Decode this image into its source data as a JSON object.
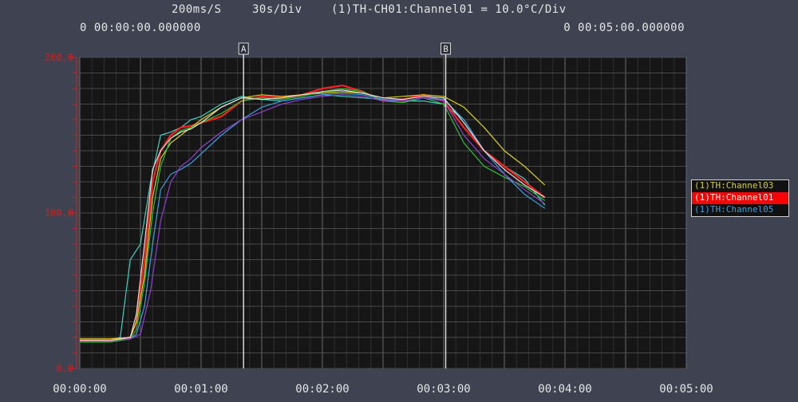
{
  "header": {
    "sample_rate": "200ms/S",
    "time_div": "30s/Div",
    "scale": "(1)TH-CH01:Channel01 = 10.0°C/Div",
    "time_start": "0 00:00:00.000000",
    "time_end": "0 00:05:00.000000"
  },
  "cursors": [
    {
      "label": "A",
      "time_s": 81
    },
    {
      "label": "B",
      "time_s": 181
    }
  ],
  "legend": [
    {
      "name": "(1)TH:Channel03",
      "color": "#d8d020",
      "selected": false
    },
    {
      "name": "(1)TH:Channel01",
      "color": "#ff2020",
      "selected": true
    },
    {
      "name": "(1)TH:Channel05",
      "color": "#3aa0e0",
      "selected": false
    }
  ],
  "chart_data": {
    "type": "line",
    "xlim": [
      0,
      300
    ],
    "ylim": [
      0,
      200
    ],
    "x_tick_labels": [
      "00:00:00",
      "00:01:00",
      "00:02:00",
      "00:03:00",
      "00:04:00",
      "00:05:00"
    ],
    "x_tick_values": [
      0,
      60,
      120,
      180,
      240,
      300
    ],
    "y_tick_labels": [
      "0.0",
      "100.0",
      "200.0"
    ],
    "y_tick_values": [
      0,
      100,
      200
    ],
    "grid": true,
    "legend_position": "right",
    "series": [
      {
        "color": "#40d0c0",
        "x": [
          0,
          15,
          20,
          22,
          25,
          30,
          35,
          40,
          45,
          50,
          55,
          60,
          70,
          80,
          90,
          100,
          110,
          120,
          130,
          140,
          150,
          160,
          170,
          180,
          190,
          200,
          210,
          220,
          230
        ],
        "y": [
          18,
          18,
          20,
          40,
          70,
          80,
          120,
          150,
          152,
          155,
          160,
          162,
          170,
          175,
          173,
          172,
          174,
          176,
          175,
          174,
          173,
          172,
          172,
          170,
          160,
          140,
          130,
          122,
          105
        ]
      },
      {
        "color": "#ff2020",
        "x": [
          0,
          15,
          25,
          28,
          32,
          36,
          40,
          45,
          50,
          55,
          60,
          70,
          80,
          90,
          100,
          110,
          120,
          130,
          140,
          150,
          160,
          170,
          180,
          190,
          200,
          210,
          220,
          230
        ],
        "y": [
          18,
          18,
          20,
          30,
          70,
          120,
          140,
          150,
          155,
          156,
          158,
          162,
          172,
          175,
          174,
          176,
          180,
          182,
          178,
          172,
          173,
          176,
          172,
          155,
          140,
          130,
          120,
          110
        ]
      },
      {
        "color": "#d8d020",
        "x": [
          0,
          15,
          25,
          28,
          32,
          36,
          40,
          45,
          50,
          55,
          60,
          70,
          80,
          90,
          100,
          110,
          120,
          130,
          140,
          150,
          160,
          170,
          180,
          190,
          200,
          210,
          220,
          230
        ],
        "y": [
          19,
          19,
          20,
          30,
          60,
          110,
          135,
          145,
          150,
          155,
          160,
          168,
          174,
          176,
          175,
          176,
          177,
          178,
          177,
          174,
          175,
          176,
          175,
          168,
          155,
          140,
          130,
          118
        ]
      },
      {
        "color": "#30c030",
        "x": [
          0,
          15,
          25,
          28,
          32,
          36,
          40,
          45,
          50,
          55,
          60,
          70,
          80,
          90,
          100,
          110,
          120,
          130,
          140,
          150,
          160,
          170,
          180,
          190,
          200,
          210,
          220,
          230
        ],
        "y": [
          17,
          17,
          19,
          25,
          55,
          100,
          130,
          148,
          153,
          155,
          158,
          164,
          172,
          174,
          173,
          175,
          178,
          180,
          178,
          172,
          171,
          174,
          170,
          145,
          130,
          123,
          117,
          108
        ]
      },
      {
        "color": "#3aa0e0",
        "x": [
          0,
          15,
          25,
          28,
          32,
          36,
          40,
          45,
          50,
          55,
          60,
          70,
          80,
          90,
          100,
          110,
          120,
          130,
          140,
          150,
          160,
          170,
          180,
          190,
          200,
          210,
          220,
          230
        ],
        "y": [
          18,
          18,
          19,
          22,
          40,
          80,
          115,
          125,
          128,
          132,
          138,
          150,
          160,
          168,
          172,
          174,
          176,
          177,
          176,
          173,
          172,
          174,
          173,
          160,
          140,
          125,
          112,
          103
        ]
      },
      {
        "color": "#9040d0",
        "x": [
          0,
          15,
          25,
          30,
          35,
          40,
          45,
          50,
          55,
          60,
          70,
          80,
          90,
          100,
          110,
          120,
          130,
          140,
          150,
          160,
          170,
          180,
          190,
          200,
          210,
          220,
          230
        ],
        "y": [
          18,
          18,
          19,
          22,
          50,
          95,
          120,
          130,
          135,
          142,
          152,
          160,
          165,
          170,
          173,
          175,
          176,
          175,
          172,
          172,
          174,
          172,
          150,
          135,
          125,
          115,
          106
        ]
      },
      {
        "color": "#e0e0e0",
        "x": [
          0,
          15,
          25,
          28,
          32,
          36,
          40,
          45,
          50,
          55,
          60,
          70,
          80,
          90,
          100,
          110,
          120,
          130,
          140,
          150,
          160,
          170,
          180,
          190,
          200,
          210,
          220,
          230
        ],
        "y": [
          18,
          18,
          20,
          35,
          80,
          128,
          140,
          148,
          152,
          154,
          158,
          168,
          174,
          173,
          174,
          176,
          178,
          179,
          177,
          174,
          173,
          175,
          174,
          158,
          140,
          128,
          118,
          110
        ]
      }
    ]
  }
}
